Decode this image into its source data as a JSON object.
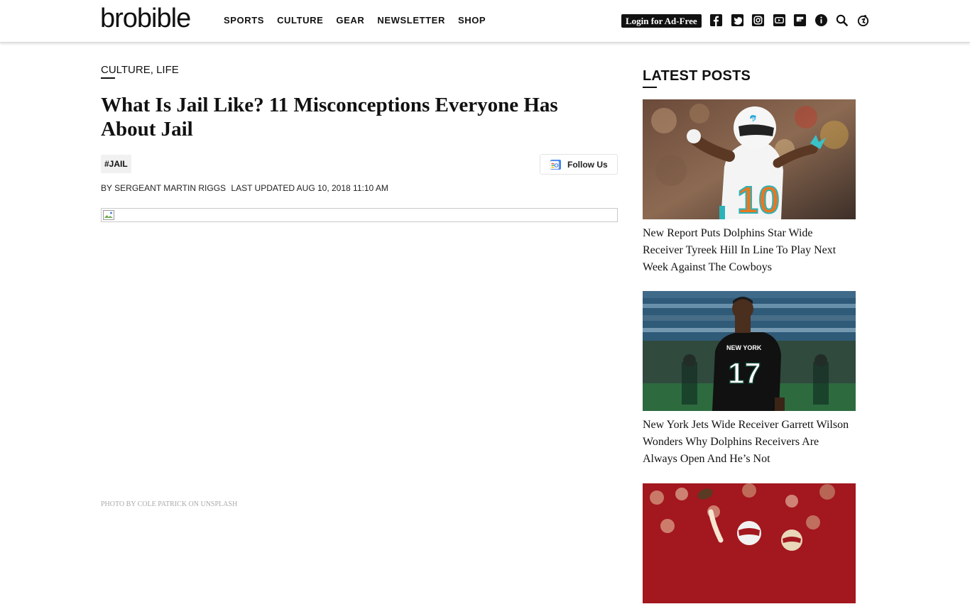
{
  "header": {
    "logo": "brobible",
    "nav": [
      "SPORTS",
      "CULTURE",
      "GEAR",
      "NEWSLETTER",
      "SHOP"
    ],
    "login_label": "Login for Ad-Free",
    "social_icons": [
      "facebook-icon",
      "twitter-icon",
      "instagram-icon",
      "youtube-icon",
      "flipboard-icon",
      "info-icon",
      "search-icon",
      "accessibility-icon"
    ]
  },
  "article": {
    "categories": [
      "CULTURE",
      "LIFE"
    ],
    "category_separator": ", ",
    "title": "What Is Jail Like? 11 Misconceptions Everyone Has About Jail",
    "tag": "#JAIL",
    "follow_label": "Follow Us",
    "byline_prefix": "BY",
    "author": "SERGEANT MARTIN RIGGS",
    "updated": "LAST UPDATED AUG 10, 2018 11:10 AM",
    "photo_credit": "PHOTO BY COLE PATRICK ON UNSPLASH"
  },
  "sidebar": {
    "heading": "LATEST POSTS",
    "posts": [
      {
        "title": "New Report Puts Dolphins Star Wide Receiver Tyreek Hill In Line To Play Next Week Against The Cowboys",
        "jersey": "10"
      },
      {
        "title": "New York Jets Wide Receiver Garrett Wilson Wonders Why Dolphins Receivers Are Always Open And He’s Not",
        "jersey": "17",
        "jersey_text": "NEW YORK"
      },
      {
        "title": ""
      }
    ]
  },
  "colors": {
    "text": "#111111",
    "dolphins_aqua": "#2bb3b8",
    "jets_green": "#0c3d2a",
    "niners_red": "#a3171e"
  }
}
